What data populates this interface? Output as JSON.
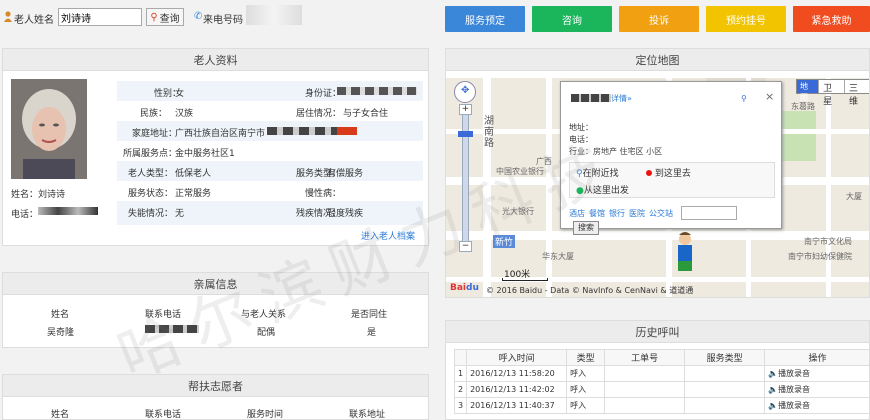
{
  "search": {
    "name_label": "老人姓名",
    "name_value": "刘诗诗",
    "query_btn": "查询",
    "phone_label": "来电号码"
  },
  "actions": [
    {
      "label": "服务预定",
      "color": "#3a86d8"
    },
    {
      "label": "咨询",
      "color": "#1bb55c"
    },
    {
      "label": "投诉",
      "color": "#f0a010"
    },
    {
      "label": "预约挂号",
      "color": "#f2c400"
    },
    {
      "label": "紧急救助",
      "color": "#f04c20"
    }
  ],
  "profile": {
    "title": "老人资料",
    "name_line": "姓名：刘诗诗",
    "phone_label": "电话：",
    "rows": [
      {
        "l1": "性别：",
        "v1": "女",
        "l2": "身份证：",
        "v2": ""
      },
      {
        "l1": "民族：",
        "v1": "汉族",
        "l2": "居住情况：",
        "v2": "与子女合住"
      },
      {
        "l1": "家庭地址：",
        "v1": "广西壮族自治区南宁市",
        "l2": "",
        "v2": ""
      },
      {
        "l1": "所属服务点：",
        "v1": "金中服务社区1",
        "l2": "",
        "v2": ""
      },
      {
        "l1": "老人类型：",
        "v1": "低保老人",
        "l2": "服务类型：",
        "v2": "有偿服务"
      },
      {
        "l1": "服务状态：",
        "v1": "正常服务",
        "l2": "慢性病：",
        "v2": ""
      },
      {
        "l1": "失能情况：",
        "v1": "无",
        "l2": "残疾情况：",
        "v2": "轻度残疾"
      }
    ],
    "archive_link": "进入老人档案"
  },
  "relatives": {
    "title": "亲属信息",
    "headers": [
      "姓名",
      "联系电话",
      "与老人关系",
      "是否同住"
    ],
    "row": [
      "吴奇隆",
      "",
      "配偶",
      "是"
    ]
  },
  "volunteers": {
    "title": "帮扶志愿者",
    "headers": [
      "姓名",
      "联系电话",
      "服务时间",
      "联系地址"
    ]
  },
  "map": {
    "title": "定位地图",
    "type_buttons": [
      "地图",
      "卫星",
      "三维"
    ],
    "popup": {
      "detail": "详情»",
      "addr": "地址：",
      "phone": "电话：",
      "category": "行业：房地产  住宅区  小区",
      "nearby": "在附近找",
      "go_here": "到这里去",
      "from_here": "从这里出发",
      "quick": [
        "酒店",
        "餐馆",
        "银行",
        "医院",
        "公交站"
      ],
      "search_btn": "搜索"
    },
    "labels": [
      "湖南路",
      "中国农业银行",
      "光大银行",
      "新竹",
      "华东大厦",
      "广西",
      "东葛路",
      "南宁市文化局",
      "南宁市妇幼保健院",
      "大厦"
    ],
    "scale": "100米",
    "copyright": "© 2016 Baidu - Data © NavInfo & CenNavi & 道道通",
    "watermark": "哈尔滨财力科技"
  },
  "history": {
    "title": "历史呼叫",
    "headers": [
      "",
      "呼入时间",
      "类型",
      "工单号",
      "服务类型",
      "操作"
    ],
    "rows": [
      {
        "n": "1",
        "time": "2016/12/13 11:58:20",
        "type": "呼入",
        "op": "播放录音"
      },
      {
        "n": "2",
        "time": "2016/12/13 11:42:02",
        "type": "呼入",
        "op": "播放录音"
      },
      {
        "n": "3",
        "time": "2016/12/13 11:40:37",
        "type": "呼入",
        "op": "播放录音"
      }
    ]
  }
}
